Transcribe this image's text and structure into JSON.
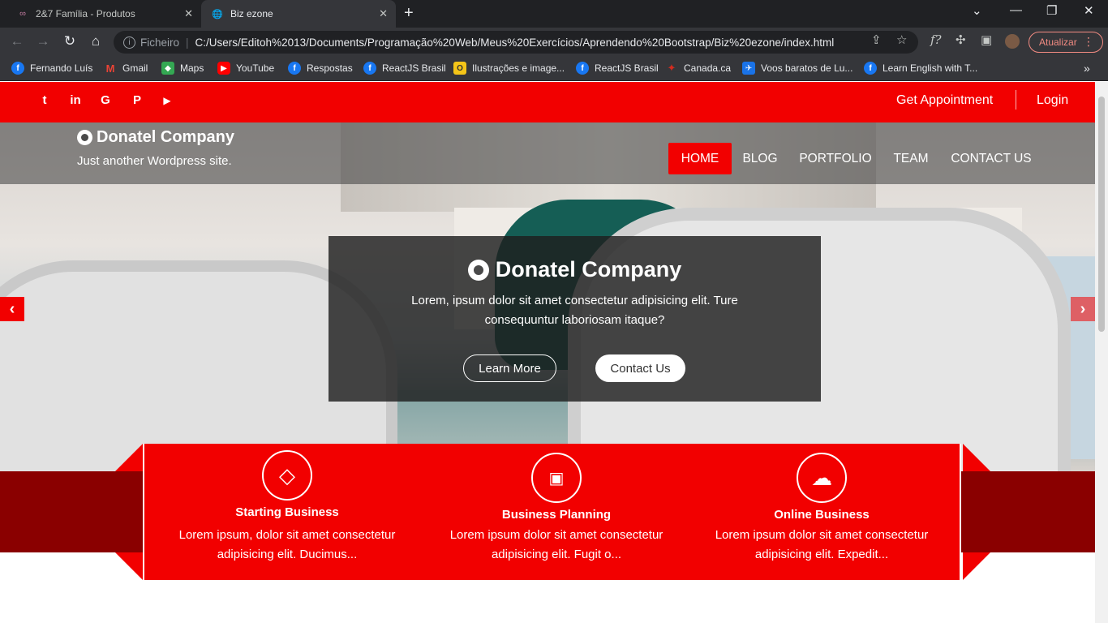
{
  "browser": {
    "tabs": [
      {
        "title": "2&7 Família - Produtos",
        "icon": "site-favicon"
      },
      {
        "title": "Biz ezone",
        "icon": "globe-icon"
      }
    ],
    "address": {
      "scheme_label": "Ficheiro",
      "url": "C:/Users/Editoh%2013/Documents/Programação%20Web/Meus%20Exercícios/Aprendendo%20Bootstrap/Biz%20ezone/index.html"
    },
    "update_label": "Atualizar",
    "bookmarks": [
      {
        "label": "Fernando Luís",
        "icon": "facebook-icon",
        "color": "#1877f2"
      },
      {
        "label": "Gmail",
        "icon": "gmail-icon",
        "color": "#ea4335"
      },
      {
        "label": "Maps",
        "icon": "maps-icon",
        "color": "#34a853"
      },
      {
        "label": "YouTube",
        "icon": "youtube-icon",
        "color": "#ff0000"
      },
      {
        "label": "Respostas",
        "icon": "facebook-icon",
        "color": "#1877f2"
      },
      {
        "label": "ReactJS Brasil",
        "icon": "facebook-icon",
        "color": "#1877f2"
      },
      {
        "label": "Ilustrações e image...",
        "icon": "ouch-icon",
        "color": "#f5c518"
      },
      {
        "label": "ReactJS Brasil",
        "icon": "facebook-icon",
        "color": "#1877f2"
      },
      {
        "label": "Canada.ca",
        "icon": "maple-leaf-icon",
        "color": "#d52b1e"
      },
      {
        "label": "Voos baratos de Lu...",
        "icon": "flights-icon",
        "color": "#1a73e8"
      },
      {
        "label": "Learn English with T...",
        "icon": "facebook-icon",
        "color": "#1877f2"
      }
    ]
  },
  "site": {
    "social": [
      {
        "glyph": "t",
        "icon": "twitter-icon"
      },
      {
        "glyph": "in",
        "icon": "linkedin-icon"
      },
      {
        "glyph": "G",
        "icon": "google-icon"
      },
      {
        "glyph": "P",
        "icon": "pinterest-icon"
      },
      {
        "glyph": "▶",
        "icon": "youtube-icon"
      }
    ],
    "top_links": {
      "appointment": "Get Appointment",
      "login": "Login"
    },
    "brand": {
      "title": "Donatel Company",
      "tagline": "Just another Wordpress site."
    },
    "menu": [
      "HOME",
      "BLOG",
      "PORTFOLIO",
      "TEAM",
      "CONTACT US"
    ],
    "active_menu": "HOME",
    "hero": {
      "title": "Donatel Company",
      "text": "Lorem, ipsum dolor sit amet consectetur adipisicing elit. Ture consequuntur laboriosam itaque?",
      "learn_more": "Learn More",
      "contact_us": "Contact Us"
    },
    "services": [
      {
        "title": "Starting Business",
        "text": "Lorem ipsum, dolor sit amet consectetur adipisicing elit. Ducimus...",
        "icon": "diamond-icon"
      },
      {
        "title": "Business Planning",
        "text": "Lorem ipsum dolor sit amet consectetur adipisicing elit. Fugit o...",
        "icon": "money-icon"
      },
      {
        "title": "Online Business",
        "text": "Lorem ipsum dolor sit amet consectetur adipisicing elit. Expedit...",
        "icon": "cloud-icon"
      }
    ],
    "colors": {
      "brand_red": "#f20000",
      "dark_red": "#8a0000"
    }
  }
}
